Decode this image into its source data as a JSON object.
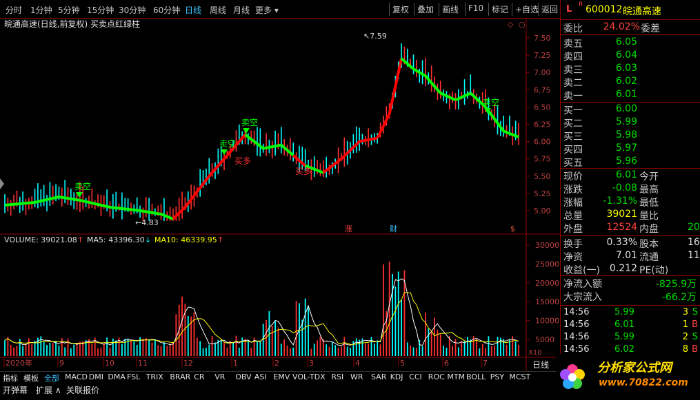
{
  "toolbar": {
    "periods": [
      "分时",
      "1分钟",
      "5分钟",
      "15分钟",
      "30分钟",
      "60分钟",
      "日线",
      "周线",
      "月线",
      "更多 ▾"
    ],
    "active_period": "日线",
    "buttons": [
      "复权",
      "叠加",
      "画线",
      "F10",
      "标记",
      "+自选",
      "返回"
    ]
  },
  "chart": {
    "title": "皖通高速(日线,前复权) 买卖点红绿柱",
    "y_ticks": [
      "7.50",
      "7.25",
      "7.00",
      "6.75",
      "6.50",
      "6.25",
      "6.00",
      "5.75",
      "5.50",
      "5.25",
      "5.00"
    ],
    "high_label": "7.59",
    "low_label": "4.83",
    "signals": [
      {
        "text": "卖空",
        "kind": "sell"
      },
      {
        "text": "卖空",
        "kind": "sell"
      },
      {
        "text": "卖空",
        "kind": "sell"
      },
      {
        "text": "卖空",
        "kind": "sell"
      },
      {
        "text": "买多",
        "kind": "buy"
      },
      {
        "text": "买多",
        "kind": "buy"
      }
    ],
    "markers": [
      "涨",
      "财",
      "$"
    ],
    "volume_label": "VOLUME: 39021.08",
    "ma5_label": "MA5: 43396.30",
    "ma10_label": "MA10: 46339.95",
    "vol_ticks": [
      "30000",
      "25000",
      "20000",
      "15000",
      "10000",
      "5000"
    ],
    "vol_unit": "X10",
    "x_labels": [
      "2020年",
      "9",
      "10",
      "11",
      "12",
      "1",
      "2",
      "3",
      "4",
      "5",
      "6",
      "7"
    ],
    "corner": "日线",
    "colors": {
      "up": "#ff3030",
      "down": "#00ffff",
      "sell_line": "#00ff00",
      "buy_line": "#ff0000",
      "ma5": "#ffffff",
      "ma10": "#ffff00",
      "grid": "#8b0000"
    }
  },
  "panel": {
    "code": "600012",
    "name": "皖通高速",
    "weibi_label": "委比",
    "weibi_value": "24.02%",
    "weicha_label": "委差",
    "asks": [
      {
        "label": "卖五",
        "price": "6.05"
      },
      {
        "label": "卖四",
        "price": "6.04"
      },
      {
        "label": "卖三",
        "price": "6.03"
      },
      {
        "label": "卖二",
        "price": "6.02"
      },
      {
        "label": "卖一",
        "price": "6.01"
      }
    ],
    "bids": [
      {
        "label": "买一",
        "price": "6.00"
      },
      {
        "label": "买二",
        "price": "5.99"
      },
      {
        "label": "买三",
        "price": "5.98"
      },
      {
        "label": "买四",
        "price": "5.97"
      },
      {
        "label": "买五",
        "price": "5.96"
      }
    ],
    "quote": [
      {
        "label": "现价",
        "value": "6.01",
        "label2": "今开"
      },
      {
        "label": "涨跌",
        "value": "-0.08",
        "label2": "最高"
      },
      {
        "label": "涨幅",
        "value": "-1.31%",
        "label2": "最低"
      },
      {
        "label": "总量",
        "value": "39021",
        "label2": "量比"
      },
      {
        "label": "外盘",
        "value": "12524",
        "label2": "内盘",
        "value2": "20"
      }
    ],
    "stats": [
      {
        "label": "换手",
        "value": "0.33%",
        "label2": "股本",
        "value2": "16"
      },
      {
        "label": "净资",
        "value": "7.01",
        "label2": "流通",
        "value2": "11"
      },
      {
        "label": "收益(一)",
        "value": "0.212",
        "label2": "PE(动)"
      }
    ],
    "flow": [
      {
        "label": "净流入额",
        "value": "-825.9万"
      },
      {
        "label": "大宗流入",
        "value": "-66.2万"
      }
    ],
    "ticks": [
      {
        "time": "14:56",
        "price": "5.99",
        "vol": "3",
        "side": "S"
      },
      {
        "time": "14:56",
        "price": "6.01",
        "vol": "1",
        "side": "B"
      },
      {
        "time": "14:56",
        "price": "5.99",
        "vol": "2",
        "side": "S"
      },
      {
        "time": "14:56",
        "price": "6.02",
        "vol": "8",
        "side": "B"
      }
    ]
  },
  "tabs": [
    "指标",
    "模板",
    "全部",
    "MACD",
    "DMI",
    "DMA",
    "FSL",
    "TRIX",
    "BRAR",
    "CR",
    "VR",
    "OBV",
    "ASI",
    "EMV",
    "VOL-TDX",
    "RSI",
    "WR",
    "SAR",
    "KDJ",
    "CCI",
    "ROC",
    "MTM",
    "BOLL",
    "PSY",
    "MCST"
  ],
  "active_tab": "全部",
  "bottom": [
    "开弹幕",
    "扩展 ∧",
    "关联报价"
  ],
  "watermark": {
    "title": "分析家公式网",
    "url": "www.70822.com"
  }
}
